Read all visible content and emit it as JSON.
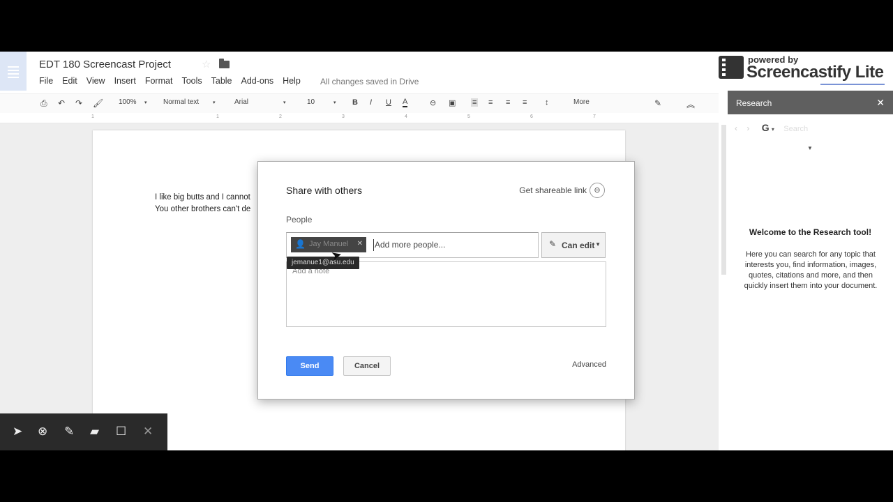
{
  "doc": {
    "title": "EDT 180 Screencast Project",
    "menu": [
      "File",
      "Edit",
      "View",
      "Insert",
      "Format",
      "Tools",
      "Table",
      "Add-ons",
      "Help"
    ],
    "saved_status": "All changes saved in Drive",
    "body_lines": [
      "I like big butts and I cannot",
      "You other brothers can't de"
    ]
  },
  "toolbar": {
    "zoom": "100%",
    "style": "Normal text",
    "font": "Arial",
    "size": "10",
    "bold": "B",
    "italic": "I",
    "underline": "U",
    "text_color": "A",
    "more": "More"
  },
  "ruler_marks": [
    "1",
    "1",
    "2",
    "3",
    "4",
    "5",
    "6",
    "7"
  ],
  "logo": {
    "powered_by": "powered by",
    "name": "Screencastify Lite"
  },
  "research": {
    "title": "Research",
    "search_placeholder": "Search",
    "welcome": "Welcome to the Research tool!",
    "description": "Here you can search for any topic that interests you, find information, images, quotes, citations and more, and then quickly insert them into your document."
  },
  "share_dialog": {
    "title": "Share with others",
    "shareable_link": "Get shareable link",
    "people_label": "People",
    "chip_name": "Jay Manuel",
    "chip_email_tooltip": "jemanue1@asu.edu",
    "add_more_placeholder": "Add more people...",
    "permission": "Can edit",
    "note_placeholder": "Add a note",
    "send_label": "Send",
    "cancel_label": "Cancel",
    "advanced_label": "Advanced"
  },
  "colors": {
    "send_blue": "#4a8af4",
    "research_header": "#5f5f5f",
    "annotation_bar": "#2a2a2a"
  }
}
